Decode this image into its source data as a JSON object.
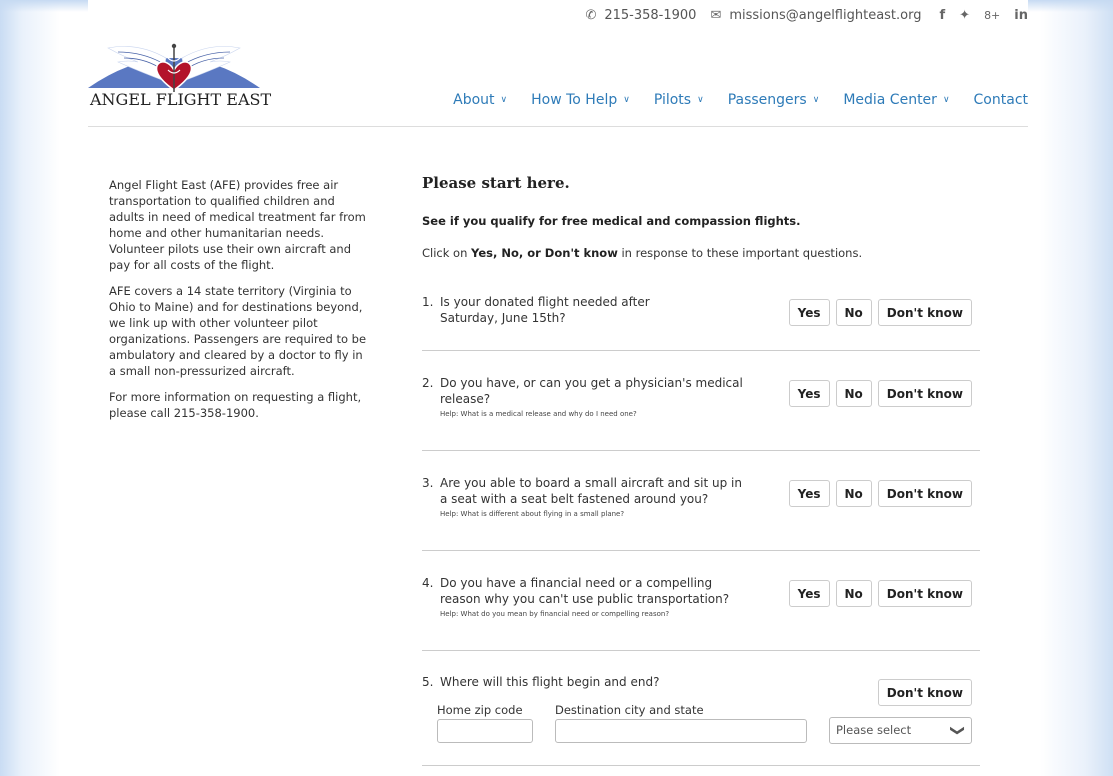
{
  "contact": {
    "phone": "215-358-1900",
    "email": "missions@angelflighteast.org",
    "social": [
      "f",
      "✦",
      "8+",
      "in"
    ]
  },
  "brand": {
    "name": "ANGEL FLIGHT EAST",
    "link_color": "#2e7bb8",
    "logo_blue": "#5a78c2",
    "heart_red": "#b3132b"
  },
  "nav": {
    "about": "About",
    "how_to_help": "How To Help",
    "pilots": "Pilots",
    "passengers": "Passengers",
    "media_center": "Media Center",
    "contact": "Contact"
  },
  "intro": {
    "p1": "Angel Flight East (AFE) provides free air transportation to qualified children and adults in need of medical treatment far from home and other humanitarian needs. Volunteer pilots use their own aircraft and pay for all costs of the flight.",
    "p2": "AFE covers a 14 state territory (Virginia to Ohio to Maine) and for destinations beyond, we link up with other volunteer pilot organizations. Passengers are required to be ambulatory and cleared by a doctor to fly in a small non-pressurized aircraft.",
    "p3": "For more information on requesting a flight, please call 215-358-1900."
  },
  "form": {
    "title": "Please start here.",
    "subtitle": "See if you qualify for free medical and compassion flights.",
    "instr_pre": "Click on ",
    "instr_bold": "Yes, No, or Don't know",
    "instr_post": " in response to these important questions.",
    "buttons": {
      "yes": "Yes",
      "no": "No",
      "dont_know": "Don't know"
    },
    "q1": {
      "num": "1.",
      "line1": "Is your donated flight needed after",
      "line2": "Saturday, June 15th?"
    },
    "q2": {
      "num": "2.",
      "line1": "Do you have, or can you get a physician's medical",
      "line2": "release?",
      "help": "Help: What is a medical release and why do I need one?"
    },
    "q3": {
      "num": "3.",
      "line1": "Are you able to board a small aircraft and sit up in",
      "line2": "a seat with a seat belt fastened around you?",
      "help": "Help: What is different about flying in a small plane?"
    },
    "q4": {
      "num": "4.",
      "line1": "Do you have a financial need or a compelling",
      "line2": "reason why you can't use public transportation?",
      "help": "Help: What do you mean by financial need or compelling reason?"
    },
    "q5": {
      "num": "5.",
      "line1": "Where will this flight begin and end?",
      "zip_label": "Home zip code",
      "zip_value": "",
      "dest_label": "Destination city and state",
      "dest_value": "",
      "select_value": "Please select"
    }
  }
}
